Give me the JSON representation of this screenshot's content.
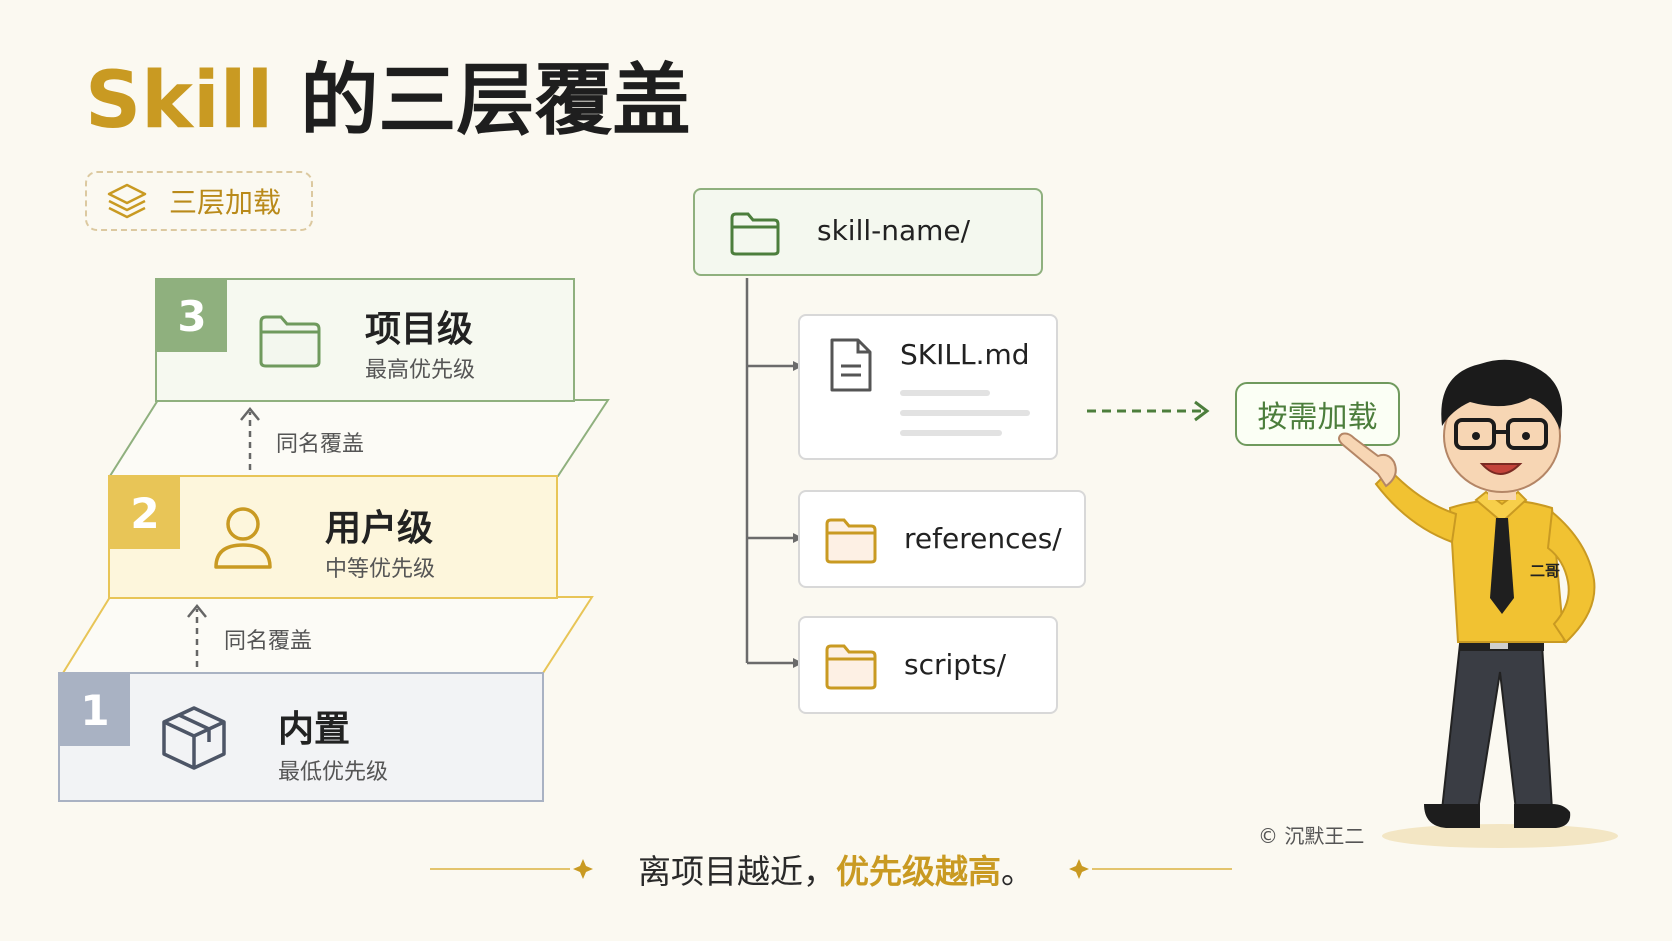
{
  "title": {
    "part1": "Skill",
    "part2": " 的三层覆盖"
  },
  "badge": {
    "label": "三层加载",
    "icon": "layers-icon"
  },
  "tiers": [
    {
      "number": "3",
      "name": "项目级",
      "sub": "最高优先级",
      "icon": "folder-icon",
      "color": "#8fb07e"
    },
    {
      "number": "2",
      "name": "用户级",
      "sub": "中等优先级",
      "icon": "user-icon",
      "color": "#e8c557"
    },
    {
      "number": "1",
      "name": "内置",
      "sub": "最低优先级",
      "icon": "box-icon",
      "color": "#a9b2c3"
    }
  ],
  "overrides": [
    "同名覆盖",
    "同名覆盖"
  ],
  "tree": {
    "root": "skill-name/",
    "children": [
      "SKILL.md",
      "references/",
      "scripts/"
    ]
  },
  "ondemand": "按需加载",
  "copyright": "© 沉默王二",
  "mascot_badge": "二哥",
  "bottom": {
    "prefix": "离项目越近，",
    "highlight": "优先级越高",
    "suffix": "。"
  },
  "colors": {
    "gold": "#c99a22",
    "green": "#6f9a5d",
    "dark": "#1e1e1e"
  }
}
